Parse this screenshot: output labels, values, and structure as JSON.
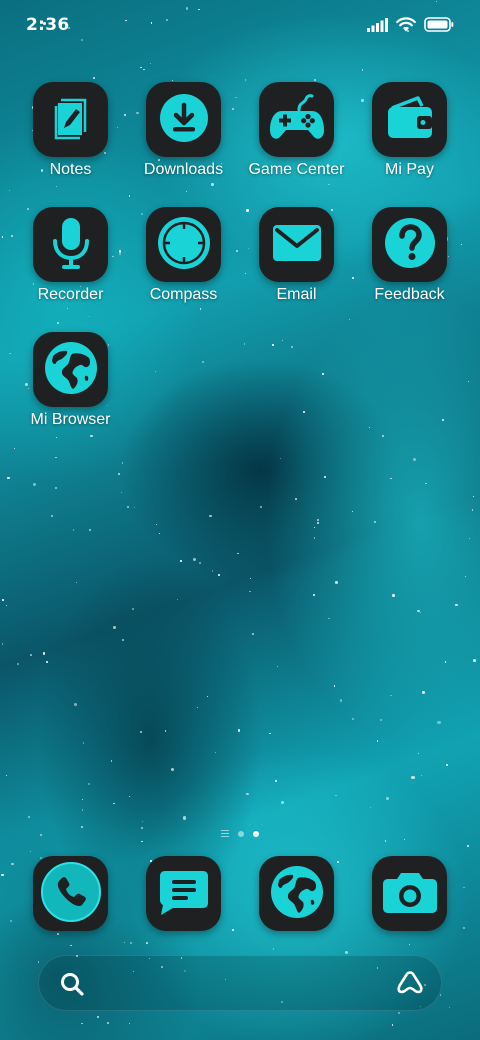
{
  "status_bar": {
    "time": "2:36",
    "icons": [
      "signal-icon",
      "wifi-icon",
      "battery-icon"
    ]
  },
  "apps": [
    {
      "label": "Notes",
      "icon": "notes-icon"
    },
    {
      "label": "Downloads",
      "icon": "download-icon"
    },
    {
      "label": "Game Center",
      "icon": "gamepad-icon"
    },
    {
      "label": "Mi Pay",
      "icon": "wallet-icon"
    },
    {
      "label": "Recorder",
      "icon": "microphone-icon"
    },
    {
      "label": "Compass",
      "icon": "compass-icon"
    },
    {
      "label": "Email",
      "icon": "envelope-icon"
    },
    {
      "label": "Feedback",
      "icon": "question-icon"
    },
    {
      "label": "Mi Browser",
      "icon": "globe-icon"
    }
  ],
  "page_indicator": {
    "pages": 2,
    "active_page": 2
  },
  "dock": [
    {
      "icon": "phone-icon"
    },
    {
      "icon": "message-icon"
    },
    {
      "icon": "globe-icon"
    },
    {
      "icon": "camera-icon"
    }
  ],
  "search_bar": {
    "icons": [
      "search-icon",
      "assistant-icon"
    ]
  },
  "colors": {
    "accent": "#19d3d6",
    "icon_background": "#1f2021"
  }
}
